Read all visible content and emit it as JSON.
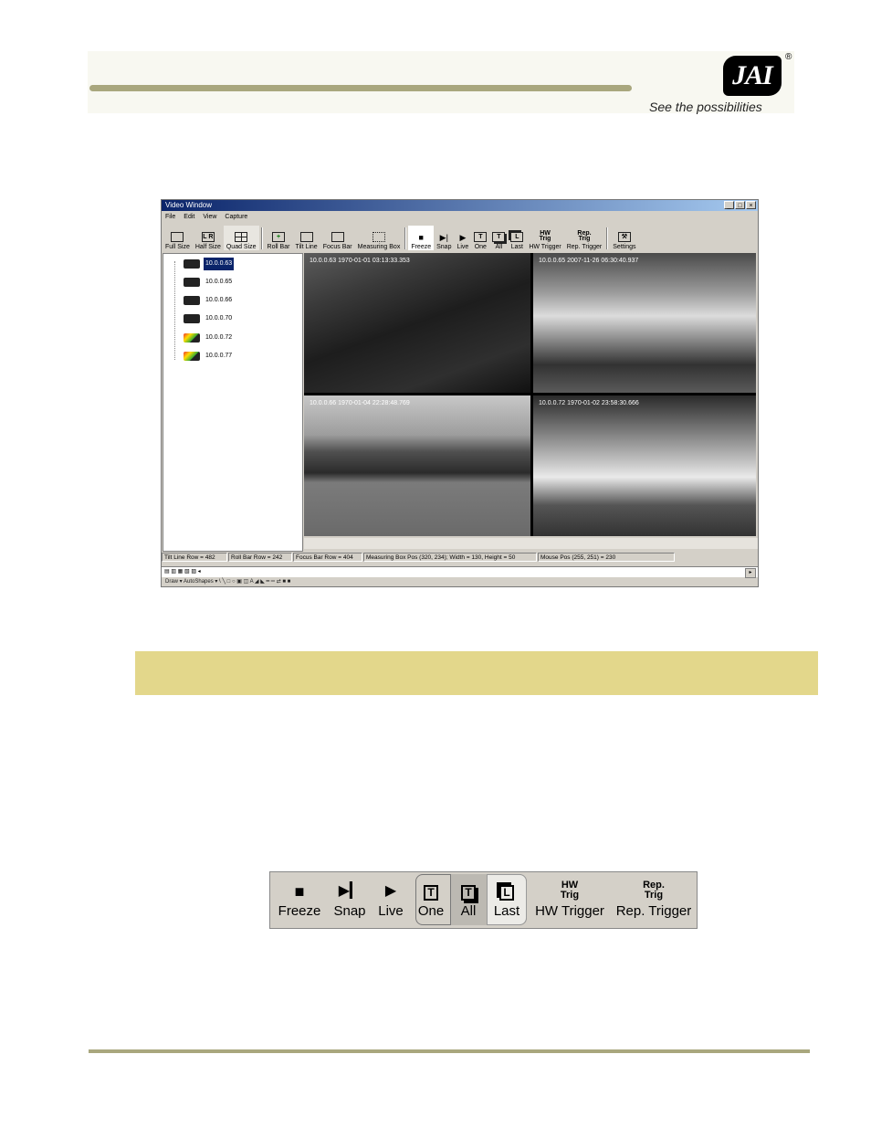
{
  "header": {
    "logo_text": "JAI",
    "registered": "®",
    "tagline": "See the possibilities"
  },
  "window": {
    "title": "Video Window",
    "controls": [
      "_",
      "□",
      "×"
    ],
    "menu": [
      "File",
      "Edit",
      "View",
      "Capture"
    ],
    "toolbar": [
      {
        "label": "Full Size",
        "icon": "square"
      },
      {
        "label": "Half Size",
        "icon": "L R"
      },
      {
        "label": "Quad Size",
        "icon": "grid"
      },
      {
        "label": "Roll Bar",
        "icon": "+"
      },
      {
        "label": "Tilt Line",
        "icon": "line"
      },
      {
        "label": "Focus Bar",
        "icon": "bar"
      },
      {
        "label": "Measuring Box",
        "icon": "box"
      },
      {
        "label": "Freeze",
        "icon": "■"
      },
      {
        "label": "Snap",
        "icon": "▶|"
      },
      {
        "label": "Live",
        "icon": "▶"
      },
      {
        "label": "One",
        "icon": "T"
      },
      {
        "label": "All",
        "icon": "T"
      },
      {
        "label": "Last",
        "icon": "L"
      },
      {
        "label": "HW Trigger",
        "icon": "HW Trig"
      },
      {
        "label": "Rep. Trigger",
        "icon": "Rep. Trig"
      },
      {
        "label": "Settings",
        "icon": "tools"
      }
    ],
    "cameras": [
      {
        "ip": "10.0.0.63",
        "color": false,
        "selected": true
      },
      {
        "ip": "10.0.0.65",
        "color": false,
        "selected": false
      },
      {
        "ip": "10.0.0.66",
        "color": false,
        "selected": false
      },
      {
        "ip": "10.0.0.70",
        "color": false,
        "selected": false
      },
      {
        "ip": "10.0.0.72",
        "color": true,
        "selected": false
      },
      {
        "ip": "10.0.0.77",
        "color": true,
        "selected": false
      }
    ],
    "video_overlays": [
      "10.0.0.63 1970-01-01 03:13:33.353",
      "10.0.0.65 2007-11-26 06:30:40.937",
      "10.0.0.66 1970-01-04 22:28:48.769",
      "10.0.0.72 1970-01-02 23:58:30.666"
    ],
    "status": [
      "Tilt Line Row = 482",
      "Roll Bar Row = 242",
      "Focus Bar Row = 404",
      "Measuring Box Pos (320, 234); Width = 130, Height = 50",
      "Mouse Pos (255, 251) = 230"
    ],
    "drawbar": "Draw ▾  AutoShapes ▾  \\  ╲  □  ○  ▣  ◫  A  ◢  ◣  ━  ═  ⇄  ■  ■"
  },
  "capture_strip": [
    {
      "label": "Freeze",
      "glyph": "■"
    },
    {
      "label": "Snap",
      "glyph": "▶▎"
    },
    {
      "label": "Live",
      "glyph": "▶"
    },
    {
      "label": "One",
      "glyph": "T"
    },
    {
      "label": "All",
      "glyph": "T"
    },
    {
      "label": "Last",
      "glyph": "L"
    },
    {
      "label": "HW Trigger",
      "glyph": "HW\nTrig"
    },
    {
      "label": "Rep. Trigger",
      "glyph": "Rep.\nTrig"
    }
  ]
}
